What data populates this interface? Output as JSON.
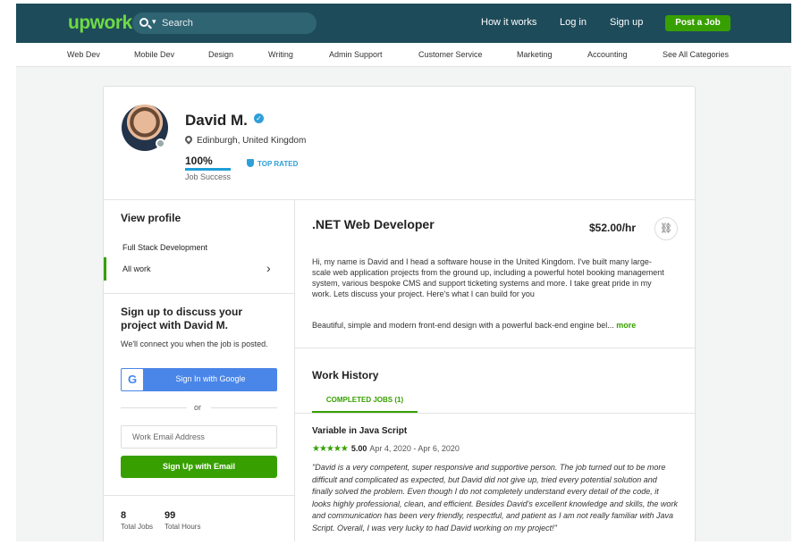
{
  "header": {
    "logo": "upwork",
    "search_placeholder": "Search",
    "nav": [
      "How it works",
      "Log in",
      "Sign up"
    ],
    "post_job": "Post a Job"
  },
  "categories": [
    "Web Dev",
    "Mobile Dev",
    "Design",
    "Writing",
    "Admin Support",
    "Customer Service",
    "Marketing",
    "Accounting",
    "See All Categories"
  ],
  "profile": {
    "name": "David M.",
    "location": "Edinburgh, United Kingdom",
    "job_success_value": "100%",
    "job_success_fraction": 1.0,
    "job_success_label": "Job Success",
    "badge": "TOP RATED"
  },
  "sidebar": {
    "view_profile": "View profile",
    "items": [
      "Full Stack Development",
      "All work"
    ],
    "signup_title": "Sign up to discuss your project with David M.",
    "signup_sub": "We'll connect you when the job is posted.",
    "google_button": "Sign In with Google",
    "or": "or",
    "email_placeholder": "Work Email Address",
    "email_button": "Sign Up with Email",
    "stats": [
      {
        "value": "8",
        "label": "Total Jobs"
      },
      {
        "value": "99",
        "label": "Total Hours"
      }
    ]
  },
  "main": {
    "title": ".NET Web Developer",
    "rate": "$52.00/hr",
    "overview": "Hi, my name is David and I head a software house in the United Kingdom. I've built many large-scale web application projects from the ground up, including a powerful hotel booking management system, various bespoke CMS and support ticketing systems and more. I take great pride in my work. Lets discuss your project. Here's what I can build for you",
    "teaser": "Beautiful, simple and modern front-end design with a powerful back-end engine bel...",
    "more": "more",
    "work_history": "Work History",
    "tab": "COMPLETED JOBS (1)",
    "job": {
      "title": "Variable in Java Script",
      "stars": "★★★★★",
      "rating": "5.00",
      "rating_value": 5.0,
      "dates": "Apr 4, 2020 - Apr 6, 2020",
      "review": "\"David is a very competent, super responsive and supportive person. The job turned out to be more difficult and complicated as expected, but David did not give up, tried every potential solution and finally solved the problem. Even though I do not completely understand every detail of the code, it looks highly professional, clean, and efficient. Besides David's excellent knowledge and skills, the work and communication has been very friendly, respectful, and patient as I am not really familiar with Java Script. Overall, I was very lucky to had David working on my project!\""
    }
  },
  "colors": {
    "header_bg": "#1e4b5a",
    "brand_green": "#6fda44",
    "accent_green": "#37a000",
    "google_blue": "#4a85e8",
    "top_rated_blue": "#2f9fd8"
  }
}
